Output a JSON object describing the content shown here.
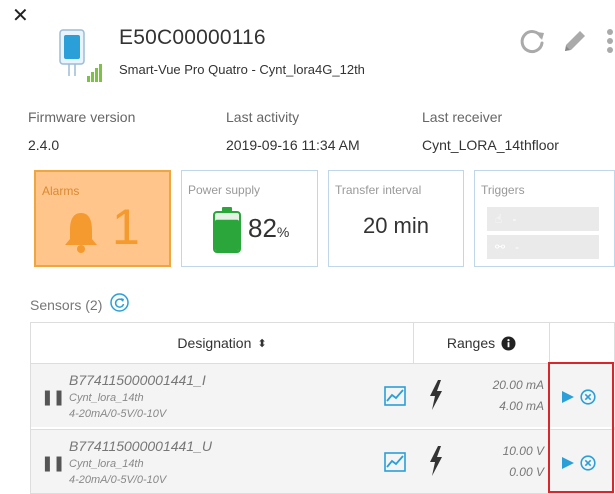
{
  "header": {
    "device_id": "E50C00000116",
    "device_model": "Smart-Vue Pro Quatro - Cynt_lora4G_12th",
    "close_icon": "close-icon",
    "actions": [
      {
        "name": "refresh-icon"
      },
      {
        "name": "edit-icon"
      },
      {
        "name": "more-icon"
      }
    ]
  },
  "info": {
    "firmware_label": "Firmware version",
    "firmware_value": "2.4.0",
    "activity_label": "Last activity",
    "activity_value": "2019-09-16 11:34 AM",
    "receiver_label": "Last receiver",
    "receiver_value": "Cynt_LORA_14thfloor"
  },
  "cards": {
    "alarms": {
      "label": "Alarms",
      "value": "1",
      "color": "#f59a2e"
    },
    "power": {
      "label": "Power supply",
      "value": "82",
      "unit": "%",
      "level": 0.82,
      "color": "#2aa63a"
    },
    "transfer": {
      "label": "Transfer interval",
      "value": "20 min"
    },
    "triggers": {
      "label": "Triggers",
      "items": [
        "-",
        "-"
      ]
    }
  },
  "sensors": {
    "title": "Sensors (2)",
    "columns": {
      "designation": "Designation",
      "ranges": "Ranges"
    },
    "rows": [
      {
        "name": "B774115000001441_I",
        "location": "Cynt_lora_14th",
        "type": "4-20mA/0-5V/0-10V",
        "range_high": "20.00 mA",
        "range_low": "4.00 mA"
      },
      {
        "name": "B774115000001441_U",
        "location": "Cynt_lora_14th",
        "type": "4-20mA/0-5V/0-10V",
        "range_high": "10.00 V",
        "range_low": "0.00 V"
      }
    ]
  },
  "colors": {
    "accent": "#2a9fd8",
    "highlight": "#d9262c",
    "alarm_bg": "#ffc58a",
    "card_border": "#bfd7e8"
  }
}
